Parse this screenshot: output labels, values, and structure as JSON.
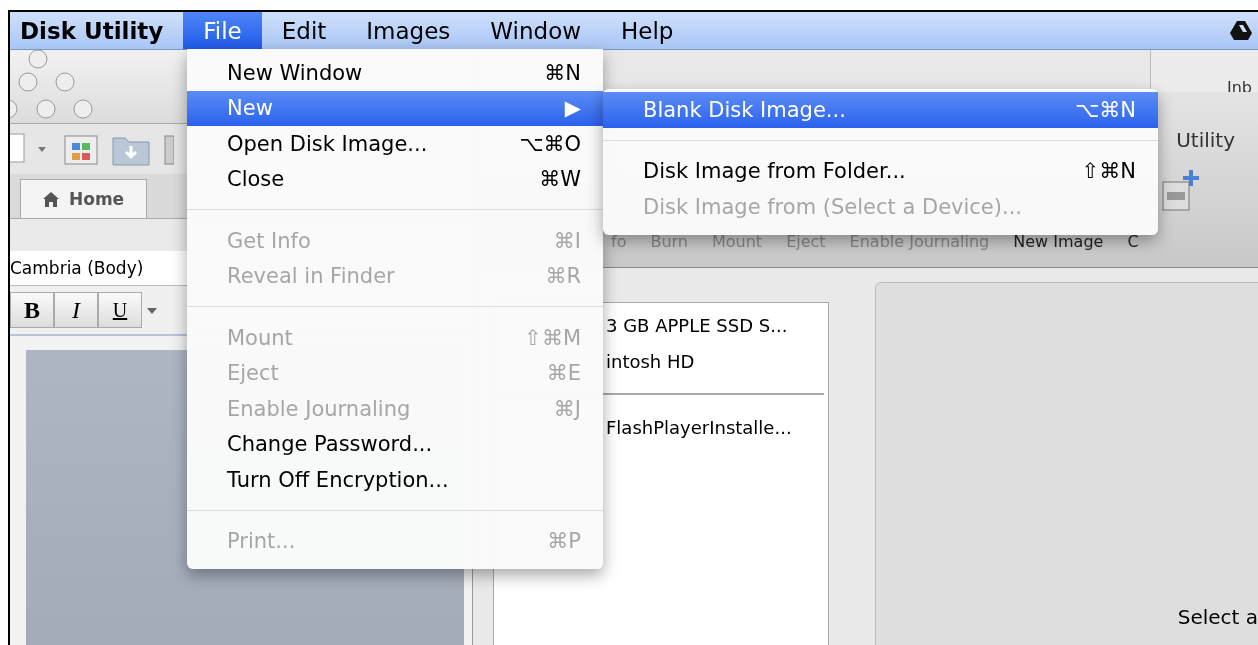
{
  "menu_bar": {
    "app_name": "Disk Utility",
    "menus": [
      {
        "label": "File",
        "selected": true
      },
      {
        "label": "Edit",
        "selected": false
      },
      {
        "label": "Images",
        "selected": false
      },
      {
        "label": "Window",
        "selected": false
      },
      {
        "label": "Help",
        "selected": false
      }
    ]
  },
  "file_menu": {
    "items": [
      {
        "kind": "item",
        "label": "New Window",
        "shortcut": "⌘N",
        "disabled": false,
        "selected": false
      },
      {
        "kind": "submenu",
        "label": "New",
        "arrow": "▶",
        "disabled": false,
        "selected": true
      },
      {
        "kind": "item",
        "label": "Open Disk Image...",
        "shortcut": "⌥⌘O",
        "disabled": false,
        "selected": false
      },
      {
        "kind": "item",
        "label": "Close",
        "shortcut": "⌘W",
        "disabled": false,
        "selected": false
      },
      {
        "kind": "separator"
      },
      {
        "kind": "item",
        "label": "Get Info",
        "shortcut": "⌘I",
        "disabled": true,
        "selected": false
      },
      {
        "kind": "item",
        "label": "Reveal in Finder",
        "shortcut": "⌘R",
        "disabled": true,
        "selected": false
      },
      {
        "kind": "separator"
      },
      {
        "kind": "item",
        "label": "Mount",
        "shortcut": "⇧⌘M",
        "disabled": true,
        "selected": false
      },
      {
        "kind": "item",
        "label": "Eject",
        "shortcut": "⌘E",
        "disabled": true,
        "selected": false
      },
      {
        "kind": "item",
        "label": "Enable Journaling",
        "shortcut": "⌘J",
        "disabled": true,
        "selected": false
      },
      {
        "kind": "item",
        "label": "Change Password...",
        "disabled": false,
        "selected": false
      },
      {
        "kind": "item",
        "label": "Turn Off Encryption...",
        "disabled": false,
        "selected": false
      },
      {
        "kind": "separator"
      },
      {
        "kind": "item",
        "label": "Print...",
        "shortcut": "⌘P",
        "disabled": true,
        "selected": false
      }
    ]
  },
  "new_submenu": {
    "items": [
      {
        "kind": "item",
        "label": "Blank Disk Image...",
        "shortcut": "⌥⌘N",
        "disabled": false,
        "selected": true
      },
      {
        "kind": "separator"
      },
      {
        "kind": "item",
        "label": "Disk Image from Folder...",
        "shortcut": "⇧⌘N",
        "disabled": false,
        "selected": false
      },
      {
        "kind": "item",
        "label": "Disk Image from (Select a Device)...",
        "disabled": true,
        "selected": false
      }
    ]
  },
  "background_window": {
    "title": "Inb"
  },
  "word_window": {
    "tab": "Home",
    "font_field": "Cambria (Body)",
    "format_buttons": [
      "B",
      "I",
      "U"
    ]
  },
  "disk_utility_window": {
    "title": "Utility",
    "toolbar": [
      {
        "label": "fo",
        "disabled": true
      },
      {
        "label": "Burn",
        "disabled": true
      },
      {
        "label": "Mount",
        "disabled": true
      },
      {
        "label": "Eject",
        "disabled": true
      },
      {
        "label": "Enable Journaling",
        "disabled": true
      },
      {
        "label": "New Image",
        "disabled": false
      },
      {
        "label": "C",
        "disabled": false
      }
    ],
    "devices": [
      {
        "label": "3 GB APPLE SSD S..."
      },
      {
        "label": "intosh HD"
      },
      {
        "kind": "divider"
      },
      {
        "label": "FlashPlayerInstalle..."
      }
    ],
    "detail_text": "Select a"
  }
}
